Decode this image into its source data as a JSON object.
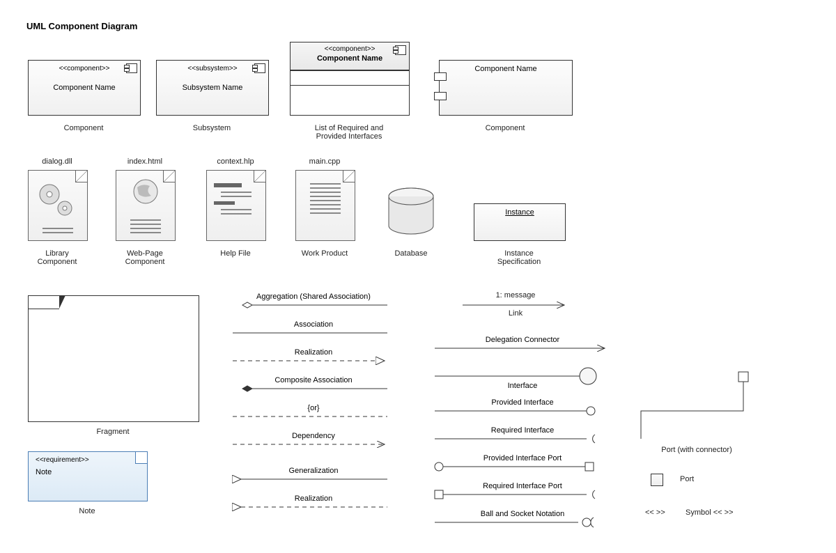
{
  "title": "UML Component Diagram",
  "row1": {
    "comp1": {
      "stereo": "<<component>>",
      "name": "Component Name",
      "label": "Component"
    },
    "subsys": {
      "stereo": "<<subsystem>>",
      "name": "Subsystem Name",
      "label": "Subsystem"
    },
    "compIfaces": {
      "stereo": "<<component>>",
      "name": "Component Name",
      "label": "List of Required and\nProvided Interfaces"
    },
    "compPorts": {
      "name": "Component Name",
      "label": "Component"
    }
  },
  "row2": {
    "lib": {
      "file": "dialog.dll",
      "label": "Library\nComponent"
    },
    "web": {
      "file": "index.html",
      "label": "Web-Page\nComponent"
    },
    "help": {
      "file": "context.hlp",
      "label": "Help File"
    },
    "work": {
      "file": "main.cpp",
      "label": "Work Product"
    },
    "db": {
      "label": "Database"
    },
    "inst": {
      "name": "Instance",
      "label": "Instance\nSpecification"
    }
  },
  "fragment": {
    "label": "Fragment"
  },
  "note": {
    "stereo": "<<requirement>>",
    "text": "Note",
    "label": "Note"
  },
  "relsLeft": [
    "Aggregation (Shared Association)",
    "Association",
    "Realization",
    "Composite Association",
    "{or}",
    "Dependency",
    "Generalization",
    "Realization"
  ],
  "linkMsg": "1: message",
  "linkLabel": "Link",
  "relsRight": [
    "Delegation Connector",
    "Interface",
    "Provided Interface",
    "Required Interface",
    "Provided Interface Port",
    "Required Interface Port",
    "Ball and Socket Notation"
  ],
  "portConn": "Port (with connector)",
  "portLabel": "Port",
  "symbolLeft": "<<  >>",
  "symbolRight": "Symbol << >>"
}
